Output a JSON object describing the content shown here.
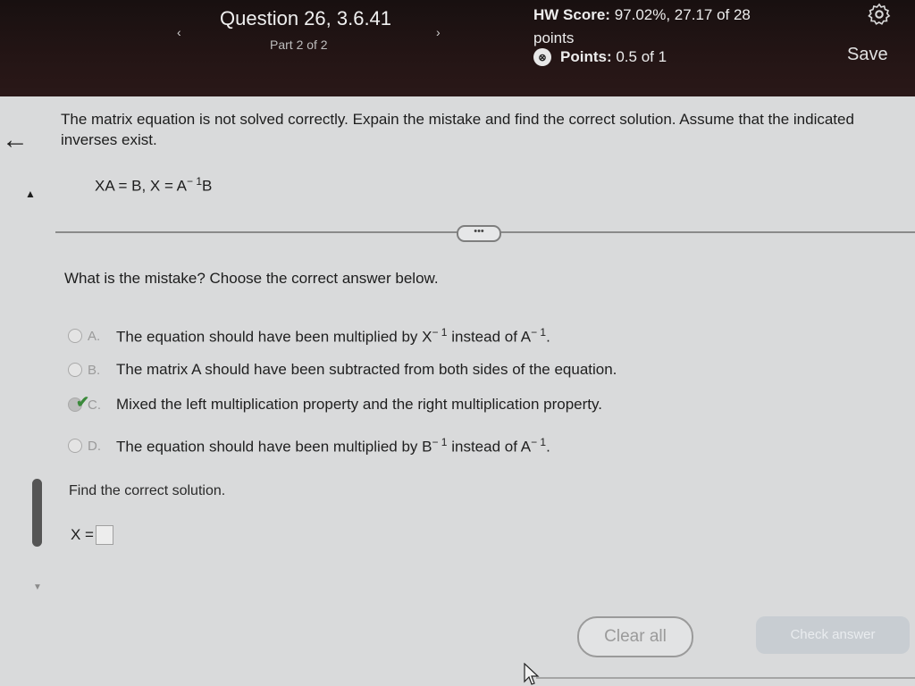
{
  "header": {
    "prev_glyph": "‹",
    "next_glyph": "›",
    "question_title": "Question 26, 3.6.41",
    "part": "Part 2 of 2",
    "hw_score_label": "HW Score:",
    "hw_score_value": "97.02%, 27.17 of 28 points",
    "points_label": "Points:",
    "points_value": "0.5 of 1",
    "points_icon": "⊗",
    "save_label": "Save"
  },
  "nav_icons": {
    "back_arrow": "←",
    "collapse": "▲",
    "scroll_down": "▼"
  },
  "question": {
    "instructions": "The matrix equation is not solved correctly. Expain the mistake and find the correct solution. Assume that the indicated inverses exist.",
    "equation_left": "XA = B, X = A",
    "equation_exp": "− 1",
    "equation_right": "B",
    "more_label": "•••",
    "prompt": "What is the mistake? Choose the correct answer below."
  },
  "choices": [
    {
      "letter": "A.",
      "text_before": "The equation should have been multiplied by X",
      "exp1": "− 1",
      "text_mid": "instead of A",
      "exp2": "− 1",
      "text_after": ".",
      "selected": false
    },
    {
      "letter": "B.",
      "text": "The matrix A should have been subtracted from both sides of the equation.",
      "selected": false
    },
    {
      "letter": "C.",
      "text": "Mixed the left multiplication property and the right multiplication property.",
      "selected": true,
      "check": "✔"
    },
    {
      "letter": "D.",
      "text_before": "The equation should have been multiplied by B",
      "exp1": "− 1",
      "text_mid": "instead of A",
      "exp2": "− 1",
      "text_after": ".",
      "selected": false
    }
  ],
  "solution": {
    "prompt": "Find the correct solution.",
    "label": "X ="
  },
  "buttons": {
    "clear_all": "Clear all",
    "check_answer": "Check answer"
  }
}
